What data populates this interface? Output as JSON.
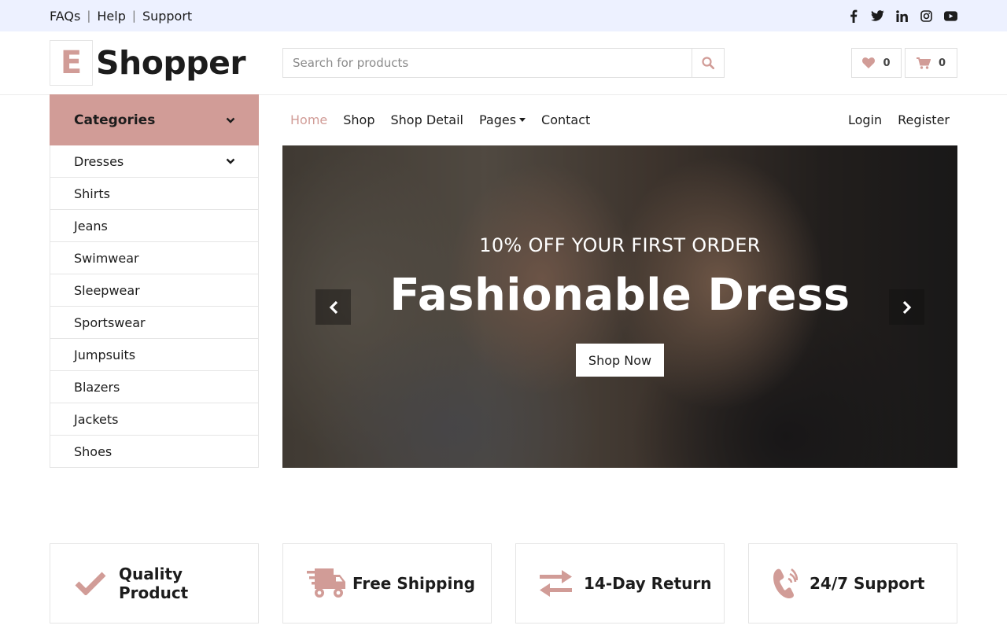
{
  "topbar": {
    "links": [
      "FAQs",
      "Help",
      "Support"
    ],
    "separator": "|",
    "social_icons": [
      "facebook-icon",
      "twitter-icon",
      "linkedin-icon",
      "instagram-icon",
      "youtube-icon"
    ]
  },
  "header": {
    "logo_letter": "E",
    "logo_text": "Shopper",
    "search_placeholder": "Search for products",
    "wishlist_count": "0",
    "cart_count": "0"
  },
  "categories": {
    "title": "Categories",
    "items": [
      "Dresses",
      "Shirts",
      "Jeans",
      "Swimwear",
      "Sleepwear",
      "Sportswear",
      "Jumpsuits",
      "Blazers",
      "Jackets",
      "Shoes"
    ]
  },
  "nav": {
    "items": [
      "Home",
      "Shop",
      "Shop Detail",
      "Pages",
      "Contact"
    ],
    "active": "Home",
    "login": "Login",
    "register": "Register"
  },
  "hero": {
    "subtitle": "10% OFF YOUR FIRST ORDER",
    "title": "Fashionable Dress",
    "button": "Shop Now"
  },
  "features": [
    {
      "icon": "check-icon",
      "label": "Quality Product"
    },
    {
      "icon": "shipping-truck-icon",
      "label": "Free Shipping"
    },
    {
      "icon": "exchange-arrows-icon",
      "label": "14-Day Return"
    },
    {
      "icon": "phone-volume-icon",
      "label": "24/7 Support"
    }
  ],
  "colors": {
    "accent": "#d19c97",
    "topbar_bg": "#edf1ff",
    "text": "#1c1c1c",
    "border": "#e5e5e5"
  }
}
